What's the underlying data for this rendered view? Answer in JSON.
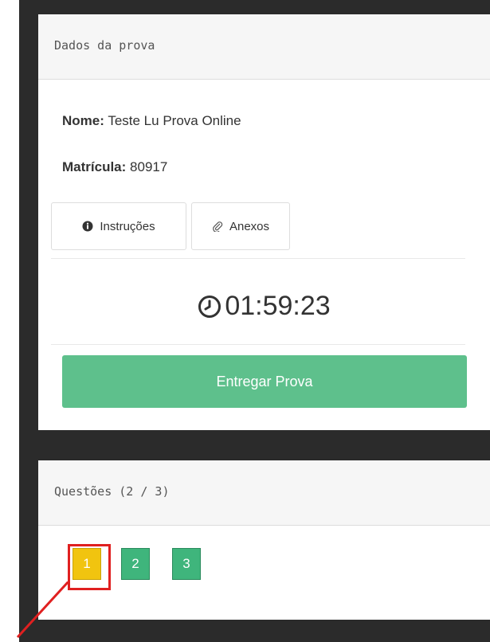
{
  "exam_panel": {
    "header": "Dados da prova",
    "name_label": "Nome:",
    "name_value": "Teste Lu Prova Online",
    "registration_label": "Matrícula:",
    "registration_value": "80917",
    "instructions_button": "Instruções",
    "attachments_button": "Anexos",
    "timer": "01:59:23",
    "submit_button": "Entregar Prova"
  },
  "questions_panel": {
    "header": "Questões (2 / 3)",
    "items": [
      {
        "label": "1",
        "status_color": "#f1c40f"
      },
      {
        "label": "2",
        "status_color": "#3fb57c"
      },
      {
        "label": "3",
        "status_color": "#3fb57c"
      }
    ]
  },
  "colors": {
    "accent_green": "#5ec08c",
    "highlight_red": "#e02020",
    "frame_dark": "#2b2b2b"
  }
}
